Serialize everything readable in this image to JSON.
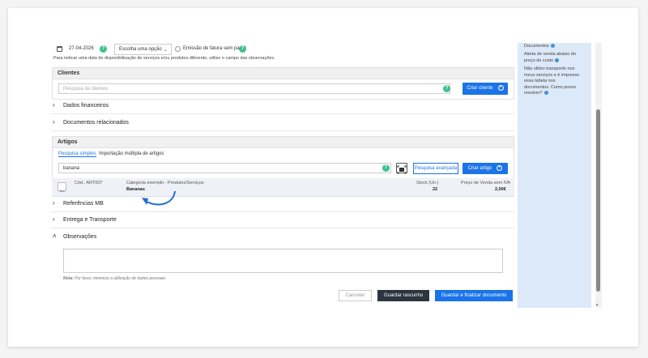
{
  "top": {
    "date": "27-04-2026",
    "select_value": "Escolha uma opção",
    "paperless_label": "Emissão de fatura sem papel",
    "hint": "Para indicar uma data de disponibilização de serviços e/ou produtos diferente, utilize o campo das observações."
  },
  "clients": {
    "title": "Clientes",
    "search_placeholder": "Pesquisa de clientes",
    "create_label": "Criar cliente"
  },
  "sections": {
    "financial": "Dados financeiros",
    "related_docs": "Documentos relacionados",
    "mb_refs": "Referências MB",
    "delivery": "Entrega e Transporte",
    "observations": "Observações"
  },
  "articles": {
    "title": "Artigos",
    "tab_simple": "Pesquisa simples",
    "tab_multiple": "Importação múltipla de artigos",
    "search_value": "banana",
    "advanced_label": "Pesquisa avançada",
    "create_label": "Criar artigo",
    "result": {
      "code": "Cód.: ART007",
      "category": "Categoria exemplo - Produtos/Serviços",
      "name": "Bananas",
      "stock_label": "Stock (Un.)",
      "stock_value": "22",
      "price_label": "Preço de Venda sem IVA",
      "price_value": "2,00€"
    }
  },
  "note": {
    "prefix": "Nota:",
    "text": " Por favor, minimize a utilização de dados pessoais."
  },
  "actions": {
    "cancel": "Cancelar",
    "save_draft": "Guardar rascunho",
    "save_finalize": "Guardar e finalizar documento"
  },
  "sidebar": {
    "line1": "Documentos",
    "line2a": "Alerta de venda abaixo do",
    "line2b": "preço de custo",
    "line3a": "Não utilizo transporte nos",
    "line3b": "meus serviços e é impresso",
    "line3c": "essa tabela nos",
    "line3d": "documentos. Como posso",
    "line3e": "resolver?"
  },
  "icons": {
    "help": "?",
    "plus": "+",
    "chevron_right": "›",
    "chevron_down": "⌄",
    "chevron_up": "˄"
  },
  "colors": {
    "primary": "#1a73e8",
    "help_green": "#3ec08a",
    "arrow_blue": "#1f6fd1",
    "sidebar_bg": "#dbe9f8"
  }
}
